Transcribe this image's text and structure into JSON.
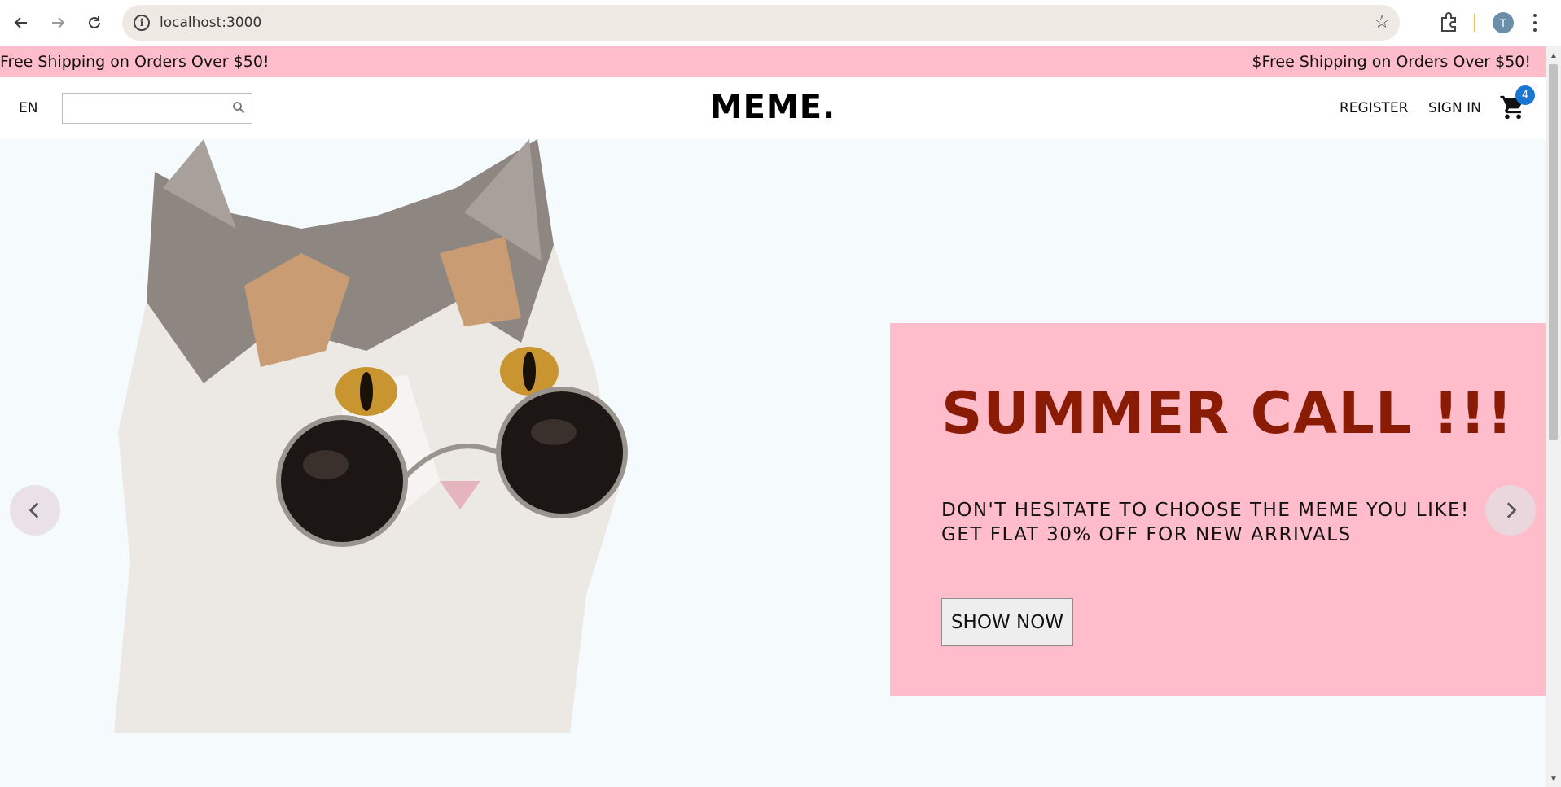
{
  "browser": {
    "url": "localhost:3000",
    "profile_initial": "T",
    "back_icon": "arrow-left-icon",
    "forward_icon": "arrow-right-icon",
    "reload_icon": "reload-icon"
  },
  "announcement": {
    "left_text": "Free Shipping on Orders Over $50!",
    "right_text": "$Free Shipping on Orders Over $50!"
  },
  "header": {
    "language": "EN",
    "search_placeholder": "",
    "logo": "MEME.",
    "register": "REGISTER",
    "sign_in": "SIGN IN",
    "cart_count": "4"
  },
  "hero": {
    "title": "SUMMER CALL !!!",
    "description": "DON'T HESITATE TO CHOOSE THE MEME YOU LIKE! GET FLAT 30% OFF FOR NEW ARRIVALS",
    "button": "SHOW NOW",
    "image_subject": "cat wearing round sunglasses"
  },
  "colors": {
    "accent_pink": "#ffbcca",
    "title_red": "#8a1c05",
    "badge_blue": "#1976d2",
    "page_bg": "#f5fafd"
  }
}
